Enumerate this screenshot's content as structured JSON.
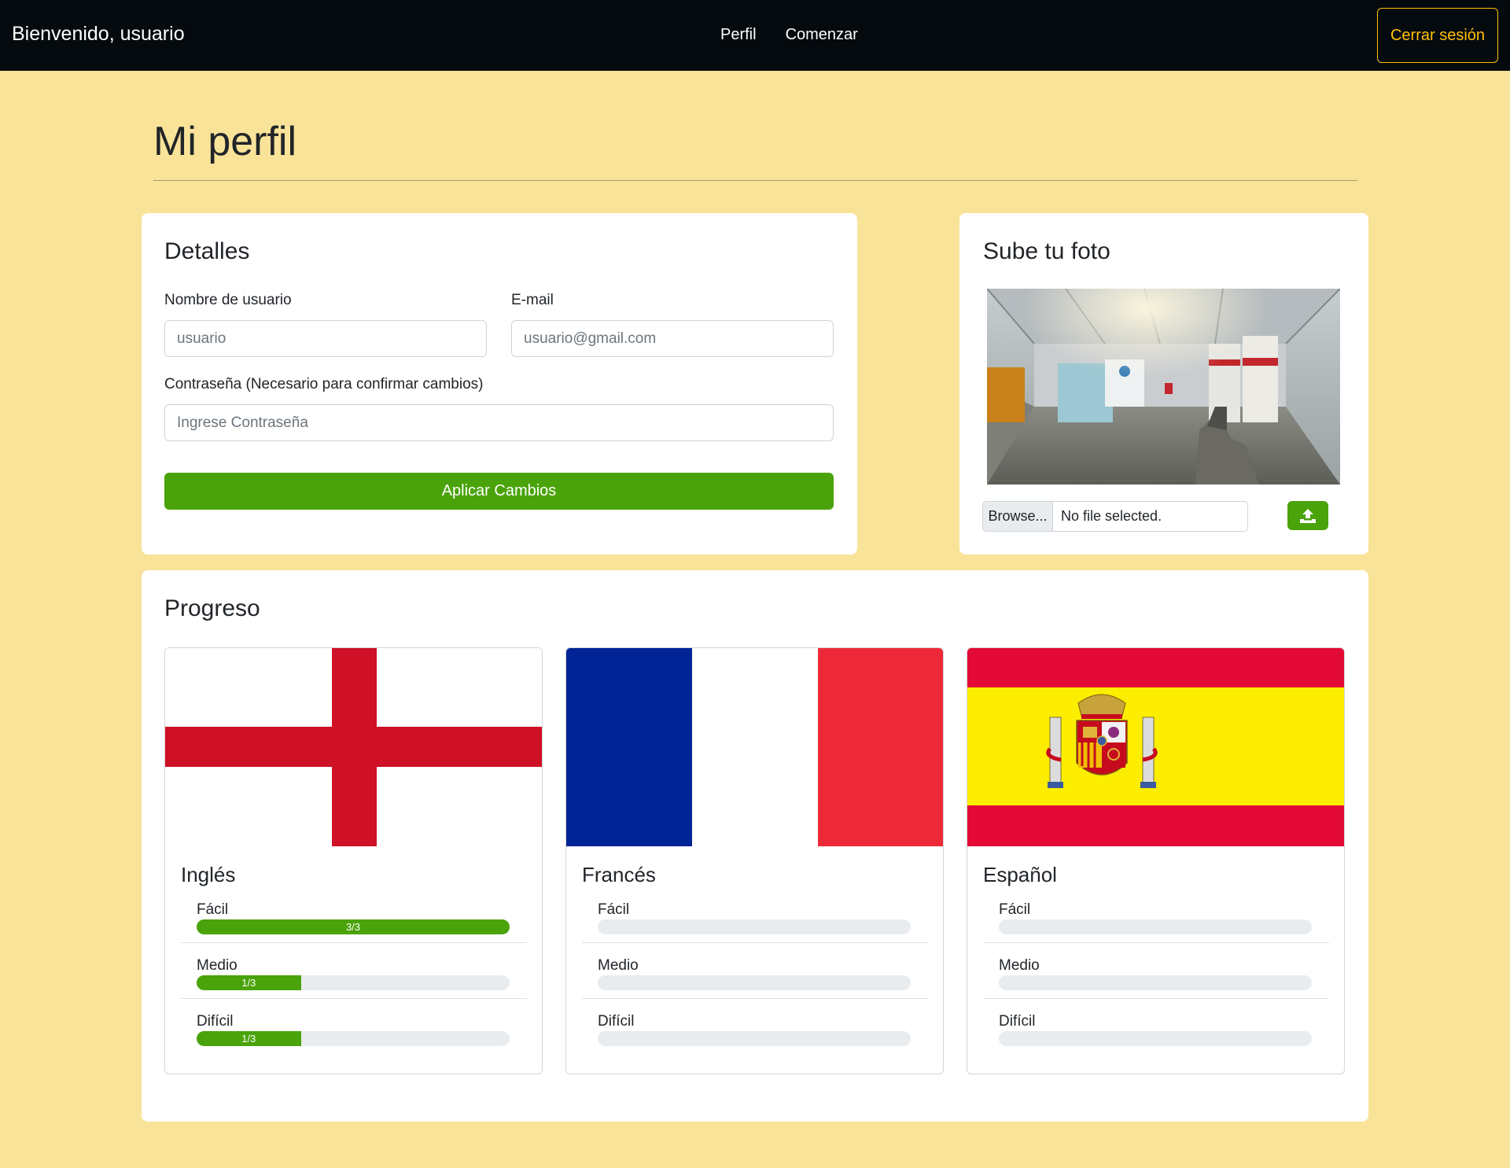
{
  "navbar": {
    "brand": "Bienvenido, usuario",
    "links": [
      "Perfil",
      "Comenzar"
    ],
    "logout": "Cerrar sesión"
  },
  "page": {
    "title": "Mi perfil"
  },
  "details": {
    "title": "Detalles",
    "username_label": "Nombre de usuario",
    "username_placeholder": "usuario",
    "email_label": "E-mail",
    "email_placeholder": "usuario@gmail.com",
    "password_label": "Contraseña (Necesario para confirmar cambios)",
    "password_placeholder": "Ingrese Contraseña",
    "apply_label": "Aplicar Cambios"
  },
  "photo": {
    "title": "Sube tu foto",
    "browse_label": "Browse...",
    "file_status": "No file selected.",
    "upload_icon": "upload-icon"
  },
  "progress": {
    "title": "Progreso",
    "languages": [
      {
        "name": "Inglés",
        "flag": "england-flag",
        "levels": [
          {
            "name": "Fácil",
            "fraction": 1.0,
            "label": "3/3"
          },
          {
            "name": "Medio",
            "fraction": 0.333,
            "label": "1/3"
          },
          {
            "name": "Difícil",
            "fraction": 0.333,
            "label": "1/3"
          }
        ]
      },
      {
        "name": "Francés",
        "flag": "france-flag",
        "levels": [
          {
            "name": "Fácil",
            "fraction": 0,
            "label": ""
          },
          {
            "name": "Medio",
            "fraction": 0,
            "label": ""
          },
          {
            "name": "Difícil",
            "fraction": 0,
            "label": ""
          }
        ]
      },
      {
        "name": "Español",
        "flag": "spain-flag",
        "levels": [
          {
            "name": "Fácil",
            "fraction": 0,
            "label": ""
          },
          {
            "name": "Medio",
            "fraction": 0,
            "label": ""
          },
          {
            "name": "Difícil",
            "fraction": 0,
            "label": ""
          }
        ]
      }
    ]
  },
  "colors": {
    "background": "#f9e399",
    "navbar": "#050a0e",
    "accent_green": "#4aa30a",
    "logout_yellow": "#ffc107"
  }
}
